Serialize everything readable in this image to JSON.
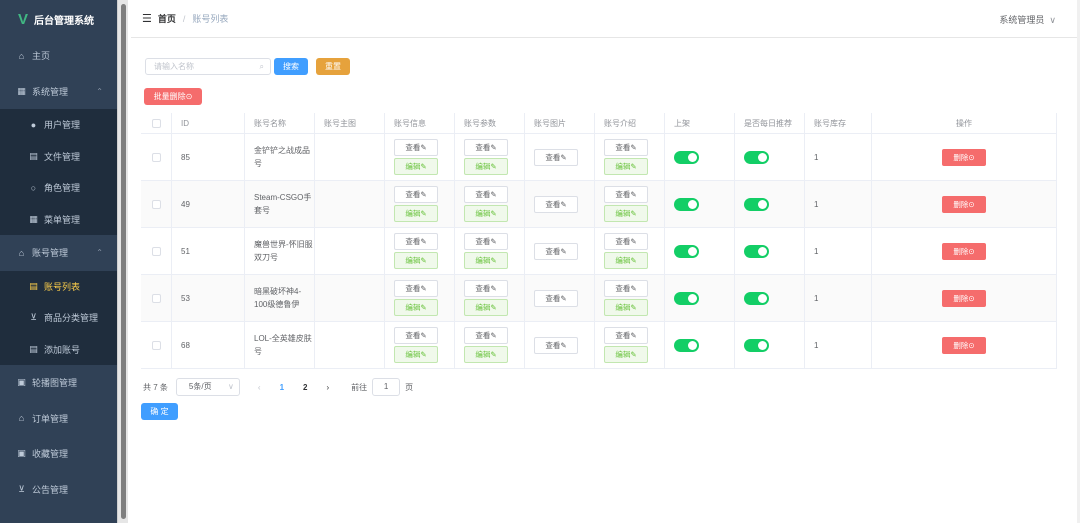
{
  "app": {
    "title": "后台管理系统",
    "logo_letter": "V"
  },
  "sidebar": {
    "items": [
      {
        "label": "主页",
        "icon": "home-icon",
        "glyph": "⌂"
      },
      {
        "label": "系统管理",
        "icon": "grid-icon",
        "glyph": "▦",
        "expanded": true
      },
      {
        "label": "用户管理",
        "icon": "user-icon",
        "glyph": "●",
        "sub": true
      },
      {
        "label": "文件管理",
        "icon": "file-icon",
        "glyph": "▤",
        "sub": true
      },
      {
        "label": "角色管理",
        "icon": "person-icon",
        "glyph": "○",
        "sub": true
      },
      {
        "label": "菜单管理",
        "icon": "menu-grid-icon",
        "glyph": "▦",
        "sub": true
      },
      {
        "label": "账号管理",
        "icon": "lock-icon",
        "glyph": "⌂",
        "expanded": true
      },
      {
        "label": "账号列表",
        "icon": "list-icon",
        "glyph": "▤",
        "sub": true,
        "active": true
      },
      {
        "label": "商品分类管理",
        "icon": "cart-icon",
        "glyph": "⊻",
        "sub": true
      },
      {
        "label": "添加账号",
        "icon": "doc-icon",
        "glyph": "▤",
        "sub": true
      },
      {
        "label": "轮播图管理",
        "icon": "image-icon",
        "glyph": "▣"
      },
      {
        "label": "订单管理",
        "icon": "bag-icon",
        "glyph": "⌂"
      },
      {
        "label": "收藏管理",
        "icon": "picture-icon",
        "glyph": "▣"
      },
      {
        "label": "公告管理",
        "icon": "cart-icon",
        "glyph": "⊻"
      }
    ]
  },
  "header": {
    "breadcrumb_home": "首页",
    "breadcrumb_sep": "/",
    "breadcrumb_current": "账号列表",
    "user_name": "系统管理员"
  },
  "search": {
    "placeholder": "请输入名称",
    "search_label": "搜索",
    "reset_label": "重置"
  },
  "batch_delete_label": "批量删除⊙",
  "table": {
    "headers": [
      "ID",
      "账号名称",
      "账号主图",
      "账号信息",
      "账号参数",
      "账号图片",
      "账号介绍",
      "上架",
      "是否每日推荐",
      "账号库存",
      "操作"
    ],
    "view_label": "查看✎",
    "edit_label": "编辑✎",
    "delete_label": "删除⊙",
    "rows": [
      {
        "id": "85",
        "name": "金铲铲之战成品号",
        "on_shelf": true,
        "daily_recommend": true,
        "stock": "1"
      },
      {
        "id": "49",
        "name": "Steam-CSGO手套号",
        "on_shelf": true,
        "daily_recommend": true,
        "stock": "1"
      },
      {
        "id": "51",
        "name": "魔兽世界-怀旧服双刀号",
        "on_shelf": true,
        "daily_recommend": true,
        "stock": "1"
      },
      {
        "id": "53",
        "name": "暗黑破坏神4-100级德鲁伊",
        "on_shelf": true,
        "daily_recommend": true,
        "stock": "1"
      },
      {
        "id": "68",
        "name": "LOL-全英雄皮肤号",
        "on_shelf": true,
        "daily_recommend": true,
        "stock": "1"
      }
    ]
  },
  "pagination": {
    "total_label": "共 7 条",
    "page_size": "5条/页",
    "prev": "‹",
    "pages": [
      "1",
      "2"
    ],
    "current_page": "1",
    "next": "›",
    "goto_label": "前往",
    "goto_value": "1",
    "goto_unit": "页"
  },
  "confirm_label": "确 定",
  "colors": {
    "sidebar_bg": "#304156",
    "active_menu": "#ffd04b",
    "primary": "#409eff",
    "warning": "#e6a23c",
    "danger": "#f56c6c",
    "switch_on": "#13ce66"
  }
}
